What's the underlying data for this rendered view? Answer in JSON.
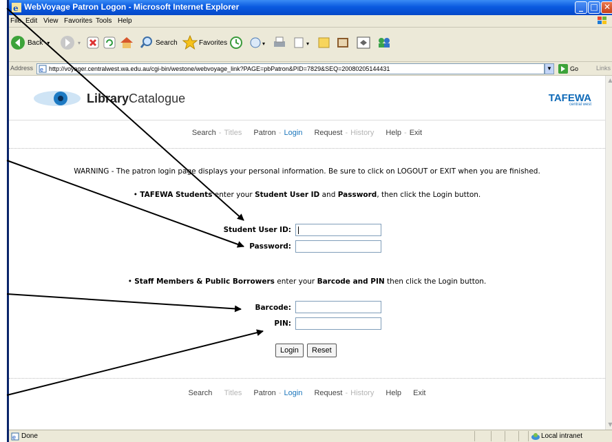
{
  "window": {
    "title": "WebVoyage Patron Logon - Microsoft Internet Explorer",
    "controls": [
      "minimize",
      "maximize",
      "close"
    ]
  },
  "menu": [
    "File",
    "Edit",
    "View",
    "Favorites",
    "Tools",
    "Help"
  ],
  "toolbar": {
    "back": "Back",
    "search": "Search",
    "favorites": "Favorites"
  },
  "address": {
    "label": "Address",
    "url": "http://voyager.centralwest.wa.edu.au/cgi-bin/westone/webvoyage_link?PAGE=pbPatron&PID=7829&SEQ=20080205144431",
    "go": "Go",
    "links": "Links"
  },
  "page": {
    "logo_bold": "Library",
    "logo_rest": "Catalogue",
    "brand": "TAFEWA",
    "brand_sub": "central west",
    "nav_top": {
      "search": "Search",
      "titles": "Titles",
      "patron": "Patron",
      "login": "Login",
      "request": "Request",
      "history": "History",
      "help": "Help",
      "exit": "Exit"
    },
    "warning": "WARNING - The patron login page displays your personal information. Be sure to click on LOGOUT or EXIT when you are finished.",
    "students": {
      "bold1": "TAFEWA Students",
      "t1": " enter your ",
      "bold2": "Student User ID",
      "t2": " and ",
      "bold3": "Password",
      "t3": ", then click the Login button."
    },
    "student_id_label": "Student User ID:",
    "password_label": "Password:",
    "staff": {
      "bold1": "Staff Members & Public Borrowers",
      "t1": " enter your ",
      "bold2": "Barcode and PIN",
      "t2": " then click the Login button."
    },
    "barcode_label": "Barcode:",
    "pin_label": "PIN:",
    "login_button": "Login",
    "reset_button": "Reset",
    "nav_bottom": {
      "search": "Search",
      "titles": "Titles",
      "patron": "Patron",
      "login": "Login",
      "request": "Request",
      "history": "History",
      "help": "Help",
      "exit": "Exit"
    }
  },
  "status": {
    "text": "Done",
    "zone": "Local intranet"
  }
}
